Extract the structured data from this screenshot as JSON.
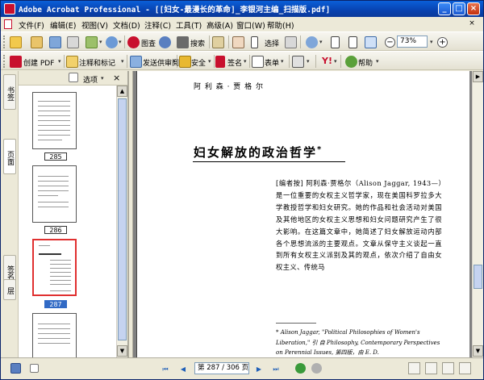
{
  "window": {
    "title": "Adobe Acrobat Professional - [[妇女-最漫长的革命]_李银河主编_扫描版.pdf]",
    "controls": {
      "minimize": "_",
      "maximize": "□",
      "close": "×"
    }
  },
  "menubar": {
    "items": [
      "文件(F)",
      "编辑(E)",
      "视图(V)",
      "文档(D)",
      "注释(C)",
      "工具(T)",
      "高级(A)",
      "窗口(W)",
      "帮助(H)"
    ],
    "close_doc": "×"
  },
  "toolbar1": {
    "search_label": "搜索",
    "select_label": "选择",
    "zoom_value": "73%",
    "zoom_out": "−",
    "zoom_in": "+"
  },
  "toolbar2": {
    "create_pdf": "创建 PDF",
    "comment_markup": "注释和标记",
    "send_review": "发送供审阅",
    "secure": "安全",
    "sign": "签名",
    "forms": "表单",
    "help": "帮助"
  },
  "left_tabs": [
    "书签",
    "页面",
    "签名",
    "层"
  ],
  "thumbnail_panel": {
    "options_label": "选项",
    "close": "×",
    "pages": [
      {
        "label": "285",
        "selected": false
      },
      {
        "label": "286",
        "selected": false
      },
      {
        "label": "287",
        "selected": true
      },
      {
        "label": "",
        "selected": false
      }
    ]
  },
  "document": {
    "running_head": "阿 利 森 · 贾 格 尔",
    "title": "妇女解放的政治哲学",
    "title_marker": "*",
    "body": "[编者按] 阿利森·贾格尔（Alison Jaggar, 1943—）是一位重要的女权主义哲学家，现在美国科罗拉多大学教授哲学和妇女研究。她的作品和社会活动对美国及其他地区的女权主义思想和妇女问题研究产生了很大影响。在这篇文章中，她简述了妇女解放运动内部各个思想流派的主要观点。文章从保守主义谈起一直到所有女权主义派别及其的观点，依次介绍了自由女权主义、传统马",
    "footnote": "* Alison Jaggar, \"Political Philosophies of Women's Liberation,\" 引 自 Philosophy, Contemporary Perspectives on Perennial Issues, 第四版，由 E. D."
  },
  "statusbar": {
    "page_indicator": "第 287 / 306 页",
    "first": "⏮",
    "prev": "◀",
    "next": "▶",
    "last": "⏭"
  },
  "colors": {
    "titlebar": "#0842b0",
    "selection": "#316ac5",
    "doc_background": "#808080"
  }
}
